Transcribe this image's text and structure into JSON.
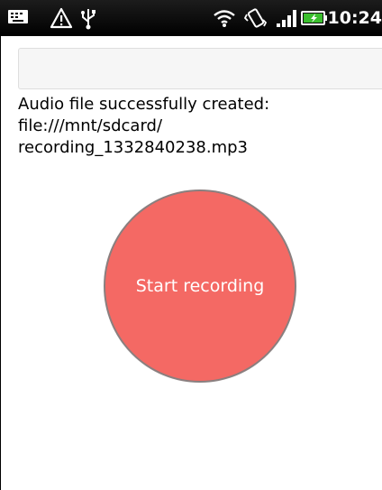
{
  "status_bar": {
    "time": "10:24",
    "icons": [
      "keyboard-icon",
      "warning-icon",
      "usb-icon",
      "wifi-icon",
      "vibrate-icon",
      "signal-icon",
      "battery-charging-icon"
    ]
  },
  "input": {
    "value": "",
    "placeholder": ""
  },
  "message": {
    "line1": "Audio file successfully created:",
    "line2": "file:///mnt/sdcard/",
    "line3": "recording_1332840238.mp3"
  },
  "record_button": {
    "label": "Start recording",
    "color": "#f46964"
  }
}
